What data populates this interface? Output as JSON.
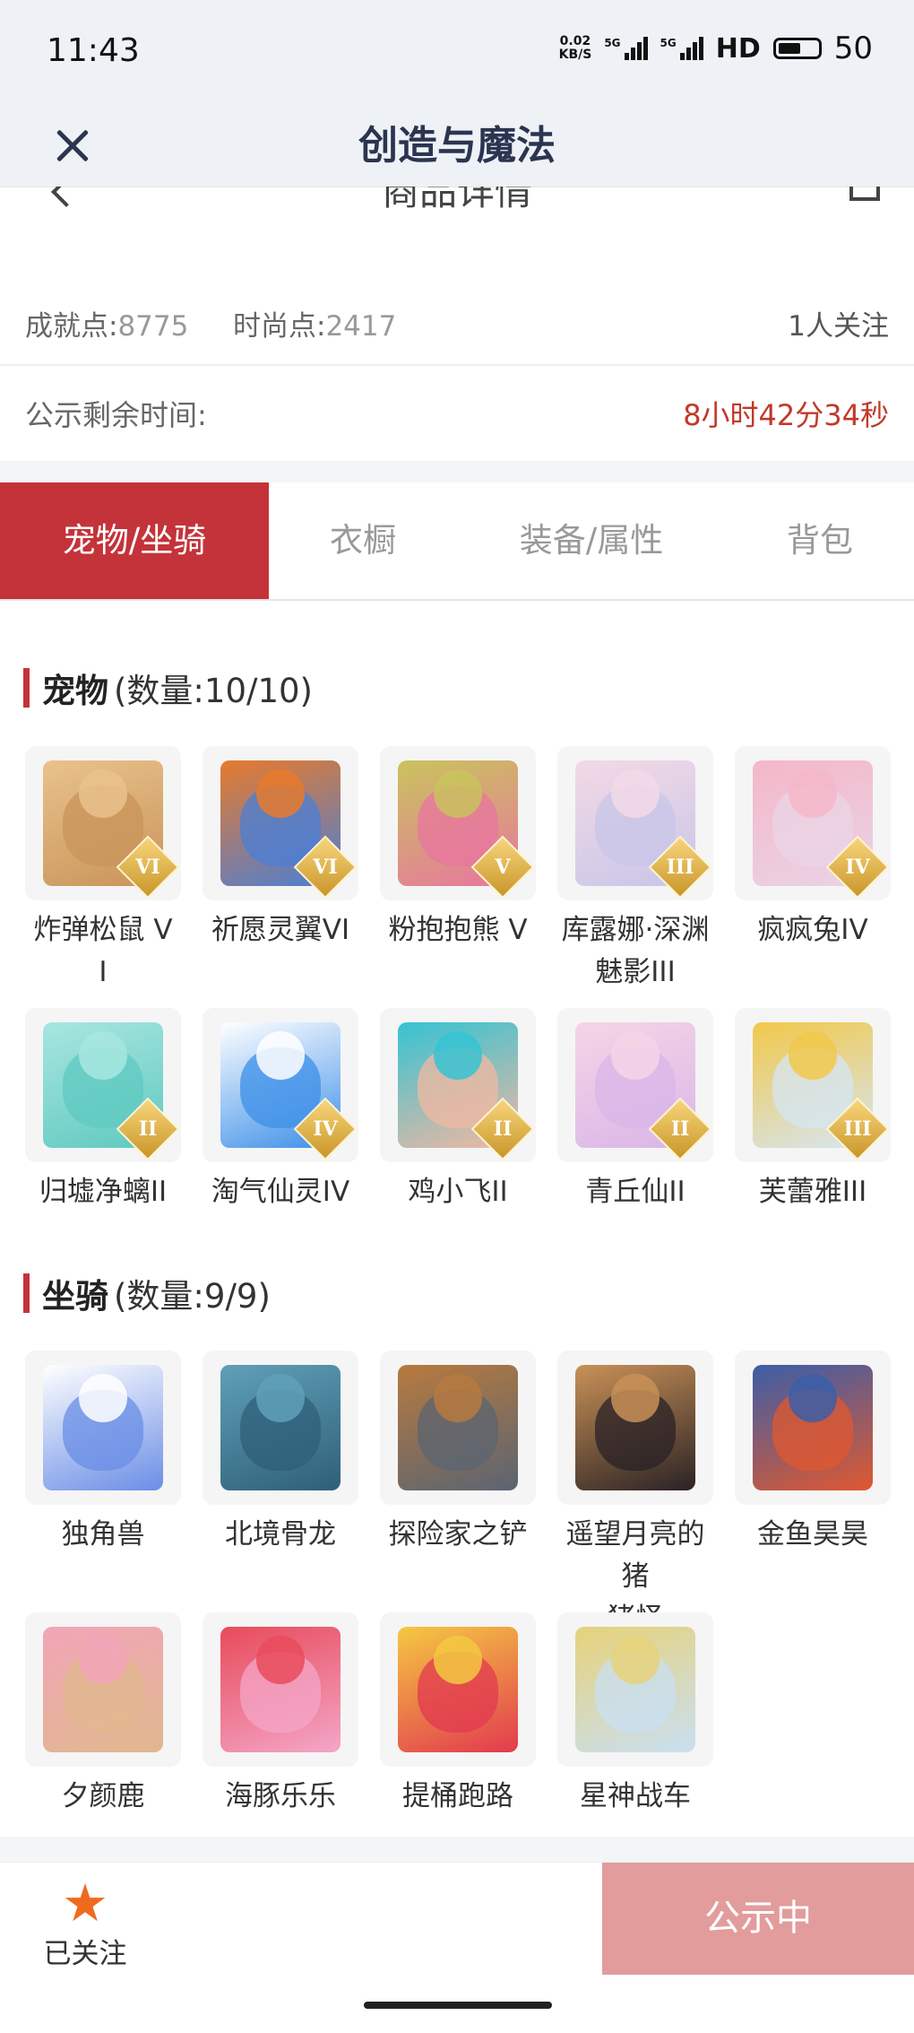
{
  "status_bar": {
    "time": "11:43",
    "net_speed_value": "0.02",
    "net_speed_unit": "KB/S",
    "sim1_label": "5G",
    "sim2_label": "5G",
    "hd_label": "HD",
    "battery": "50"
  },
  "header": {
    "title": "创造与魔法",
    "subtitle": "商品详情"
  },
  "stats": {
    "achievement_label": "成就点:",
    "achievement_value": "8775",
    "fashion_label": "时尚点:",
    "fashion_value": "2417",
    "followers": "1人关注"
  },
  "publicity": {
    "label": "公示剩余时间:",
    "remaining": "8小时42分34秒"
  },
  "tabs": [
    {
      "label": "宠物/坐骑",
      "active": true
    },
    {
      "label": "衣橱",
      "active": false
    },
    {
      "label": "装备/属性",
      "active": false
    },
    {
      "label": "背包",
      "active": false
    }
  ],
  "pets": {
    "title": "宠物",
    "count": "(数量:10/10)",
    "items": [
      {
        "label": "炸弹松鼠 VI",
        "rank": "VI",
        "icon": "squirrel-pet-icon",
        "color": "#c8945a",
        "color2": "#e9c28c"
      },
      {
        "label": "祈愿灵翼VI",
        "rank": "VI",
        "icon": "winged-bird-pet-icon",
        "color": "#4b7fd6",
        "color2": "#e77a2c"
      },
      {
        "label": "粉抱抱熊 V",
        "rank": "V",
        "icon": "pink-bear-pet-icon",
        "color": "#e8769f",
        "color2": "#c9c35d"
      },
      {
        "label": "库露娜·深渊魅影III",
        "rank": "III",
        "icon": "fairy-girl-pet-icon",
        "color": "#c8c6e8",
        "color2": "#f3d9e6"
      },
      {
        "label": "疯疯兔IV",
        "rank": "IV",
        "icon": "crazy-rabbit-pet-icon",
        "color": "#e9d4e6",
        "color2": "#f4b7c8"
      },
      {
        "label": "归墟净螭II",
        "rank": "II",
        "icon": "water-dragon-pet-icon",
        "color": "#5fc9c0",
        "color2": "#a8e6e0"
      },
      {
        "label": "淘气仙灵IV",
        "rank": "IV",
        "icon": "blue-puppy-pet-icon",
        "color": "#3c8fe8",
        "color2": "#ffffff"
      },
      {
        "label": "鸡小飞II",
        "rank": "II",
        "icon": "chick-pet-icon",
        "color": "#f2b8a1",
        "color2": "#35c3d3"
      },
      {
        "label": "青丘仙II",
        "rank": "II",
        "icon": "fox-fairy-pet-icon",
        "color": "#d9b6e8",
        "color2": "#f6d4e6"
      },
      {
        "label": "芙蕾雅III",
        "rank": "III",
        "icon": "valkyrie-pet-icon",
        "color": "#d6e6f3",
        "color2": "#f1c84a"
      }
    ]
  },
  "mounts": {
    "title": "坐骑",
    "count": "(数量:9/9)",
    "items": [
      {
        "label": "独角兽",
        "icon": "unicorn-mount-icon",
        "color": "#6a8de6",
        "color2": "#ffffff"
      },
      {
        "label": "北境骨龙",
        "icon": "bone-dragon-mount-icon",
        "color": "#2f5f78",
        "color2": "#5fa0b8"
      },
      {
        "label": "探险家之铲",
        "icon": "shovel-mount-icon",
        "color": "#5b6472",
        "color2": "#b77a3e"
      },
      {
        "label": "遥望月亮的猪猪怪",
        "icon": "pig-mount-icon",
        "color": "#2a2225",
        "color2": "#c99157"
      },
      {
        "label": "金鱼昊昊",
        "icon": "goldfish-mount-icon",
        "color": "#e0582f",
        "color2": "#3b5ea8"
      },
      {
        "label": "夕颜鹿",
        "icon": "deer-mount-icon",
        "color": "#e0b88e",
        "color2": "#f2a5b8"
      },
      {
        "label": "海豚乐乐",
        "icon": "dolphin-mount-icon",
        "color": "#f4a6c8",
        "color2": "#e84b5a"
      },
      {
        "label": "提桶跑路",
        "icon": "bucket-mount-icon",
        "color": "#e23a4f",
        "color2": "#f5c842"
      },
      {
        "label": "星神战车",
        "icon": "star-chariot-mount-icon",
        "color": "#c9dff2",
        "color2": "#e6d27a"
      }
    ]
  },
  "bottom_bar": {
    "follow_label": "已关注",
    "publish_label": "公示中"
  },
  "colors": {
    "accent": "#c4333a",
    "countdown": "#c0392b",
    "publish_button": "#e29c9c",
    "star": "#ef6a1f"
  }
}
